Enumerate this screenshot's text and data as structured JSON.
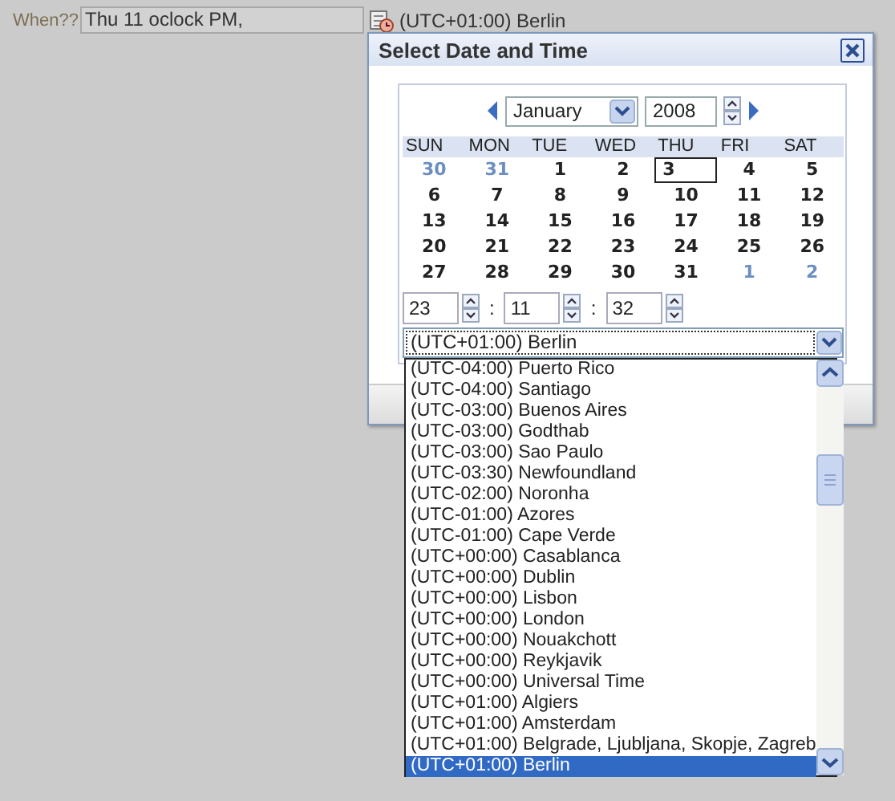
{
  "field": {
    "label": "When??",
    "value": "Thu 11 oclock PM,",
    "timezone": "(UTC+01:00) Berlin"
  },
  "dialog": {
    "title": "Select Date and Time",
    "month": "January",
    "year": "2008",
    "weekdays": [
      "SUN",
      "MON",
      "TUE",
      "WED",
      "THU",
      "FRI",
      "SAT"
    ],
    "weeks": [
      [
        {
          "label": "30",
          "other_month": true,
          "selected": false
        },
        {
          "label": "31",
          "other_month": true,
          "selected": false
        },
        {
          "label": "1",
          "other_month": false,
          "selected": false
        },
        {
          "label": "2",
          "other_month": false,
          "selected": false
        },
        {
          "label": "3",
          "other_month": false,
          "selected": true
        },
        {
          "label": "4",
          "other_month": false,
          "selected": false
        },
        {
          "label": "5",
          "other_month": false,
          "selected": false
        }
      ],
      [
        {
          "label": "6",
          "other_month": false,
          "selected": false
        },
        {
          "label": "7",
          "other_month": false,
          "selected": false
        },
        {
          "label": "8",
          "other_month": false,
          "selected": false
        },
        {
          "label": "9",
          "other_month": false,
          "selected": false
        },
        {
          "label": "10",
          "other_month": false,
          "selected": false
        },
        {
          "label": "11",
          "other_month": false,
          "selected": false
        },
        {
          "label": "12",
          "other_month": false,
          "selected": false
        }
      ],
      [
        {
          "label": "13",
          "other_month": false,
          "selected": false
        },
        {
          "label": "14",
          "other_month": false,
          "selected": false
        },
        {
          "label": "15",
          "other_month": false,
          "selected": false
        },
        {
          "label": "16",
          "other_month": false,
          "selected": false
        },
        {
          "label": "17",
          "other_month": false,
          "selected": false
        },
        {
          "label": "18",
          "other_month": false,
          "selected": false
        },
        {
          "label": "19",
          "other_month": false,
          "selected": false
        }
      ],
      [
        {
          "label": "20",
          "other_month": false,
          "selected": false
        },
        {
          "label": "21",
          "other_month": false,
          "selected": false
        },
        {
          "label": "22",
          "other_month": false,
          "selected": false
        },
        {
          "label": "23",
          "other_month": false,
          "selected": false
        },
        {
          "label": "24",
          "other_month": false,
          "selected": false
        },
        {
          "label": "25",
          "other_month": false,
          "selected": false
        },
        {
          "label": "26",
          "other_month": false,
          "selected": false
        }
      ],
      [
        {
          "label": "27",
          "other_month": false,
          "selected": false
        },
        {
          "label": "28",
          "other_month": false,
          "selected": false
        },
        {
          "label": "29",
          "other_month": false,
          "selected": false
        },
        {
          "label": "30",
          "other_month": false,
          "selected": false
        },
        {
          "label": "31",
          "other_month": false,
          "selected": false
        },
        {
          "label": "1",
          "other_month": true,
          "selected": false
        },
        {
          "label": "2",
          "other_month": true,
          "selected": false
        }
      ]
    ],
    "time": {
      "hour": "23",
      "minute": "11",
      "second": "32",
      "separators": [
        ":",
        ":"
      ]
    },
    "timezone": "(UTC+01:00) Berlin",
    "timezone_options": [
      {
        "label": "(UTC-04:00) Puerto Rico",
        "selected": false
      },
      {
        "label": "(UTC-04:00) Santiago",
        "selected": false
      },
      {
        "label": "(UTC-03:00) Buenos Aires",
        "selected": false
      },
      {
        "label": "(UTC-03:00) Godthab",
        "selected": false
      },
      {
        "label": "(UTC-03:00) Sao Paulo",
        "selected": false
      },
      {
        "label": "(UTC-03:30) Newfoundland",
        "selected": false
      },
      {
        "label": "(UTC-02:00) Noronha",
        "selected": false
      },
      {
        "label": "(UTC-01:00) Azores",
        "selected": false
      },
      {
        "label": "(UTC-01:00) Cape Verde",
        "selected": false
      },
      {
        "label": "(UTC+00:00) Casablanca",
        "selected": false
      },
      {
        "label": "(UTC+00:00) Dublin",
        "selected": false
      },
      {
        "label": "(UTC+00:00) Lisbon",
        "selected": false
      },
      {
        "label": "(UTC+00:00) London",
        "selected": false
      },
      {
        "label": "(UTC+00:00) Nouakchott",
        "selected": false
      },
      {
        "label": "(UTC+00:00) Reykjavik",
        "selected": false
      },
      {
        "label": "(UTC+00:00) Universal Time",
        "selected": false
      },
      {
        "label": "(UTC+01:00) Algiers",
        "selected": false
      },
      {
        "label": "(UTC+01:00) Amsterdam",
        "selected": false
      },
      {
        "label": "(UTC+01:00) Belgrade, Ljubljana, Skopje, Zagreb",
        "selected": false
      },
      {
        "label": "(UTC+01:00) Berlin",
        "selected": true
      }
    ]
  }
}
